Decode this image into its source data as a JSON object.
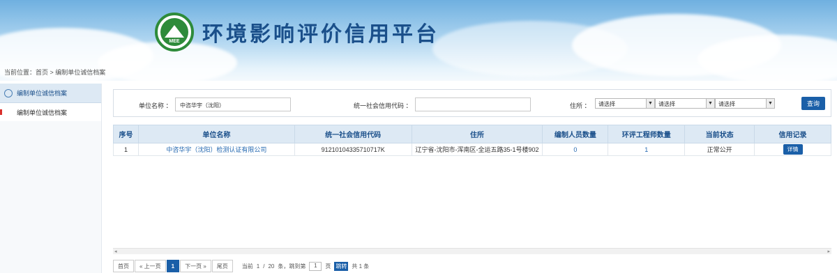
{
  "header": {
    "title": "环境影响评价信用平台",
    "logo_text": "MEE"
  },
  "breadcrumb": {
    "text": "当前位置：首页 > 编制单位诚信档案"
  },
  "sidebar": {
    "heading": "编制单位诚信档案",
    "items": [
      {
        "label": "编制单位诚信档案",
        "active": true
      }
    ]
  },
  "search": {
    "unit_label": "单位名称 ：",
    "unit_value": "中咨华宇（沈阳）",
    "code_label": "统一社会信用代码 ：",
    "code_value": "",
    "address_label": "住所 ：",
    "select_placeholder_1": "请选择",
    "select_placeholder_2": "请选择",
    "select_placeholder_3": "请选择",
    "dash": "-",
    "query_button": "查询"
  },
  "table": {
    "headers": [
      "序号",
      "单位名称",
      "统一社会信用代码",
      "住所",
      "编制人员数量",
      "环评工程师数量",
      "当前状态",
      "信用记录"
    ],
    "rows": [
      {
        "index": "1",
        "name": "中咨华宇（沈阳）检测认证有限公司",
        "code": "91210104335710717K",
        "address": "辽宁省-沈阳市-浑南区-全运五路35-1号楼902",
        "staff_count": "0",
        "engineer_count": "1",
        "status": "正常公开",
        "record_button": "详情"
      }
    ]
  },
  "pagination": {
    "first": "首页",
    "prev": "« 上一页",
    "current": "1",
    "next": "下一页 »",
    "last": "尾页",
    "current_label": "当前",
    "page": "1",
    "slash": "/",
    "per_page": "20",
    "per_page_suffix": "条，跳到第",
    "jump_value": "1",
    "page_suffix": "页",
    "go_button": "跳转",
    "total": "共 1 条"
  },
  "colors": {
    "accent": "#1a5fa8",
    "title": "#1a4f8a",
    "header_bg": "#dde9f4"
  }
}
